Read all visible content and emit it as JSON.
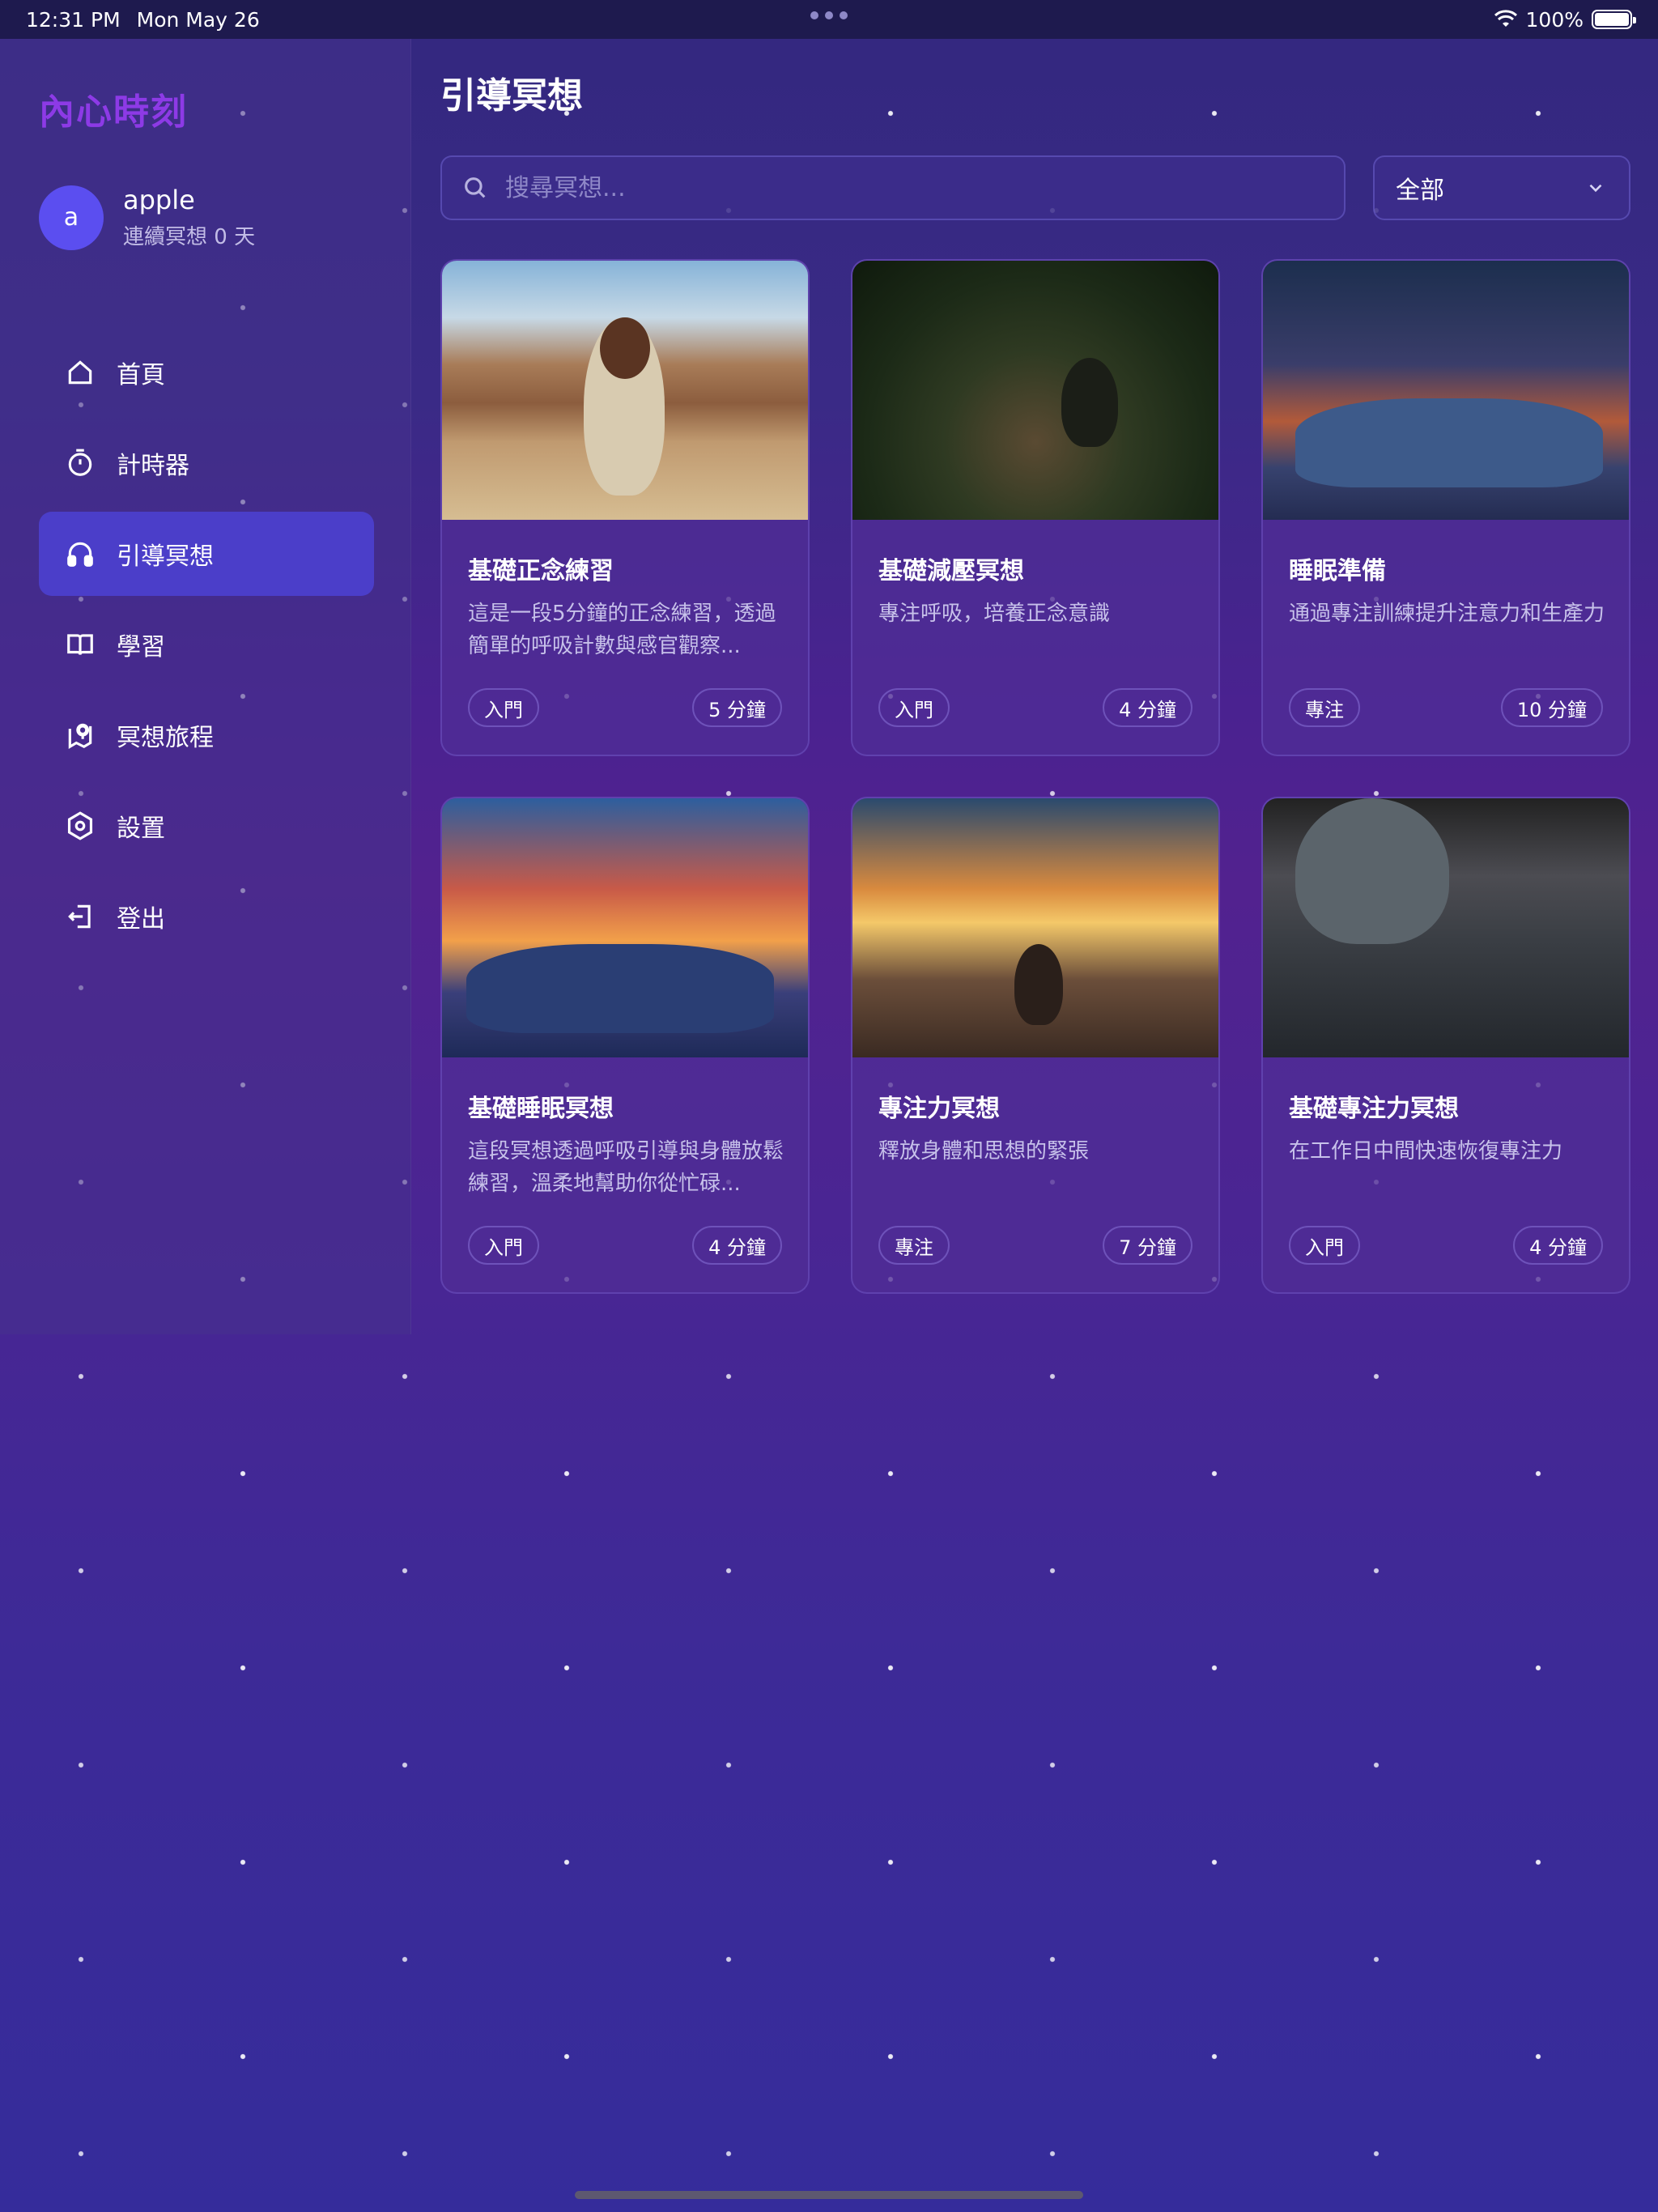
{
  "status_bar": {
    "time": "12:31 PM",
    "date": "Mon May 26",
    "battery": "100%"
  },
  "sidebar": {
    "brand": "內心時刻",
    "user": {
      "avatar_letter": "a",
      "name": "apple",
      "streak": "連續冥想 0 天"
    },
    "items": [
      {
        "label": "首頁",
        "icon": "home-icon",
        "active": false
      },
      {
        "label": "計時器",
        "icon": "timer-icon",
        "active": false
      },
      {
        "label": "引導冥想",
        "icon": "headphones-icon",
        "active": true
      },
      {
        "label": "學習",
        "icon": "book-icon",
        "active": false
      },
      {
        "label": "冥想旅程",
        "icon": "map-pin-icon",
        "active": false
      },
      {
        "label": "設置",
        "icon": "settings-icon",
        "active": false
      },
      {
        "label": "登出",
        "icon": "logout-icon",
        "active": false
      }
    ]
  },
  "main": {
    "title": "引導冥想",
    "search": {
      "placeholder": "搜尋冥想..."
    },
    "filter": {
      "selected": "全部"
    },
    "cards": [
      {
        "title": "基礎正念練習",
        "description": "這是一段5分鐘的正念練習，透過簡單的呼吸計數與感官觀察...",
        "level": "入門",
        "duration": "5 分鐘"
      },
      {
        "title": "基礎減壓冥想",
        "description": "專注呼吸，培養正念意識",
        "level": "入門",
        "duration": "4 分鐘"
      },
      {
        "title": "睡眠準備",
        "description": "通過專注訓練提升注意力和生產力",
        "level": "專注",
        "duration": "10 分鐘"
      },
      {
        "title": "基礎睡眠冥想",
        "description": "這段冥想透過呼吸引導與身體放鬆練習，溫柔地幫助你從忙碌...",
        "level": "入門",
        "duration": "4 分鐘"
      },
      {
        "title": "專注力冥想",
        "description": "釋放身體和思想的緊張",
        "level": "專注",
        "duration": "7 分鐘"
      },
      {
        "title": "基礎專注力冥想",
        "description": "在工作日中間快速恢復專注力",
        "level": "入門",
        "duration": "4 分鐘"
      }
    ]
  },
  "colors": {
    "brand": "#8d3ae6",
    "active_nav": "#4b3ec9",
    "avatar": "#5b4ef0"
  }
}
